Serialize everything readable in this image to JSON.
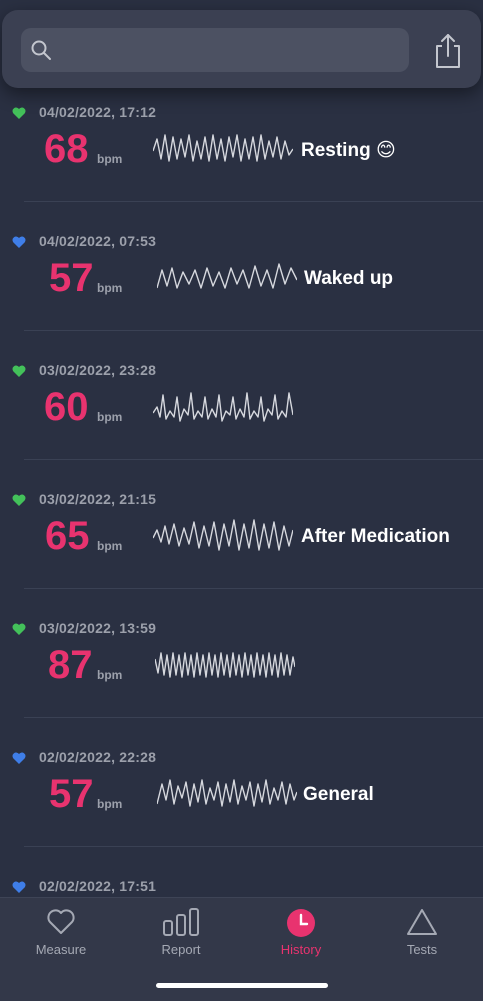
{
  "search": {
    "placeholder": "",
    "value": ""
  },
  "unit_label": "bpm",
  "colors": {
    "accent": "#e8336f",
    "heart_green": "#43c15a",
    "heart_blue": "#3f7ee8",
    "background": "#2a3042"
  },
  "entries": [
    {
      "date": "04/02/2022, 17:12",
      "bpm": "68",
      "tag": "Resting 😊",
      "heart": "green"
    },
    {
      "date": "04/02/2022, 07:53",
      "bpm": "57",
      "tag": "Waked up",
      "heart": "blue"
    },
    {
      "date": "03/02/2022, 23:28",
      "bpm": "60",
      "tag": "",
      "heart": "green"
    },
    {
      "date": "03/02/2022, 21:15",
      "bpm": "65",
      "tag": "After Medication",
      "heart": "green"
    },
    {
      "date": "03/02/2022, 13:59",
      "bpm": "87",
      "tag": "",
      "heart": "green"
    },
    {
      "date": "02/02/2022, 22:28",
      "bpm": "57",
      "tag": "General",
      "heart": "blue"
    },
    {
      "date": "02/02/2022, 17:51",
      "bpm": "",
      "tag": "",
      "heart": "blue"
    }
  ],
  "tabs": [
    {
      "label": "Measure",
      "icon": "heart-outline-icon",
      "active": false
    },
    {
      "label": "Report",
      "icon": "bar-chart-icon",
      "active": false
    },
    {
      "label": "History",
      "icon": "clock-icon",
      "active": true
    },
    {
      "label": "Tests",
      "icon": "triangle-icon",
      "active": false
    }
  ]
}
